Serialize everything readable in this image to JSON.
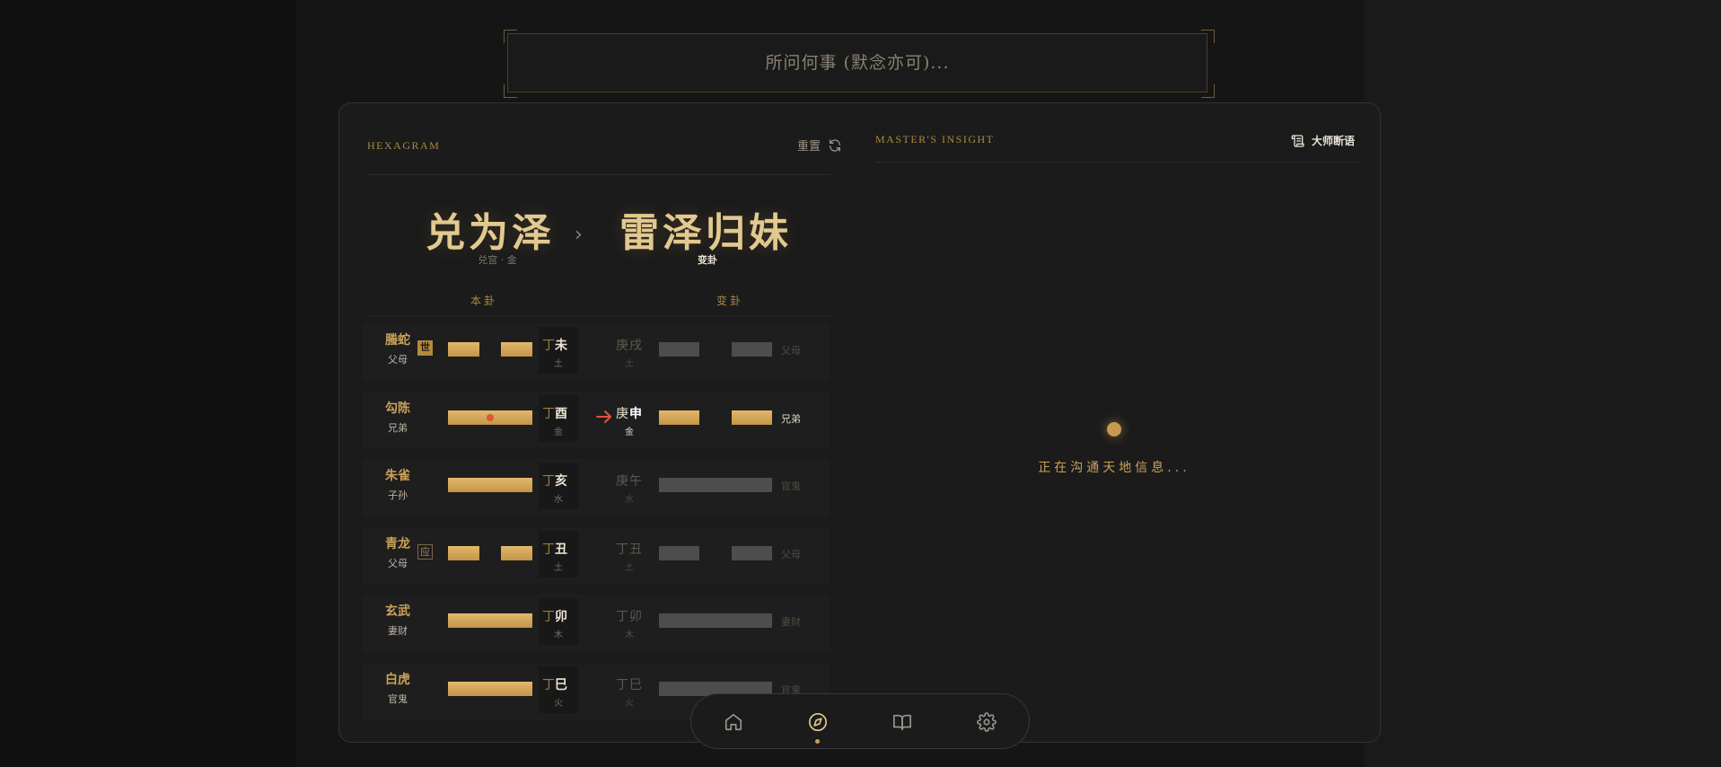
{
  "search": {
    "placeholder": "所问何事 (默念亦可)..."
  },
  "hexagram_panel": {
    "label": "HEXAGRAM",
    "reset_label": "重置",
    "primary": {
      "name": "兑为泽",
      "palace": "兑宫 · 金"
    },
    "changed": {
      "name": "雷泽归妹",
      "sub": "变卦"
    },
    "col_primary": "本卦",
    "col_changed": "变卦",
    "rows": [
      {
        "god": "螣蛇",
        "kin": "父母",
        "tag": "世",
        "stem": "丁",
        "branch": "未",
        "elem": "土",
        "r_stem": "庚",
        "r_branch": "戌",
        "r_elem": "土",
        "r_kin": "父母",
        "yin": true,
        "r_yin": true,
        "moving": false
      },
      {
        "god": "勾陈",
        "kin": "兄弟",
        "tag": "",
        "stem": "丁",
        "branch": "酉",
        "elem": "金",
        "r_stem": "庚",
        "r_branch": "申",
        "r_elem": "金",
        "r_kin": "兄弟",
        "yin": false,
        "r_yin": true,
        "moving": true
      },
      {
        "god": "朱雀",
        "kin": "子孙",
        "tag": "",
        "stem": "丁",
        "branch": "亥",
        "elem": "水",
        "r_stem": "庚",
        "r_branch": "午",
        "r_elem": "水",
        "r_kin": "官鬼",
        "yin": false,
        "r_yin": false,
        "moving": false
      },
      {
        "god": "青龙",
        "kin": "父母",
        "tag": "应",
        "stem": "丁",
        "branch": "丑",
        "elem": "土",
        "r_stem": "丁",
        "r_branch": "丑",
        "r_elem": "土",
        "r_kin": "父母",
        "yin": true,
        "r_yin": true,
        "moving": false
      },
      {
        "god": "玄武",
        "kin": "妻财",
        "tag": "",
        "stem": "丁",
        "branch": "卯",
        "elem": "木",
        "r_stem": "丁",
        "r_branch": "卯",
        "r_elem": "木",
        "r_kin": "妻财",
        "yin": false,
        "r_yin": false,
        "moving": false
      },
      {
        "god": "白虎",
        "kin": "官鬼",
        "tag": "",
        "stem": "丁",
        "branch": "巳",
        "elem": "火",
        "r_stem": "丁",
        "r_branch": "巳",
        "r_elem": "火",
        "r_kin": "官鬼",
        "yin": false,
        "r_yin": false,
        "moving": false
      }
    ]
  },
  "insight_panel": {
    "label": "MASTER'S INSIGHT",
    "button_label": "大师断语",
    "loading_text": "正在沟通天地信息..."
  },
  "nav": {
    "items": [
      {
        "icon": "home-icon"
      },
      {
        "icon": "compass-icon",
        "active": true
      },
      {
        "icon": "book-icon"
      },
      {
        "icon": "gear-icon"
      }
    ]
  },
  "colors": {
    "accent": "#c9a15a",
    "gold_bar": "#d7ac5e",
    "dim_bar": "#4d4d4d",
    "moving": "#e05533"
  }
}
